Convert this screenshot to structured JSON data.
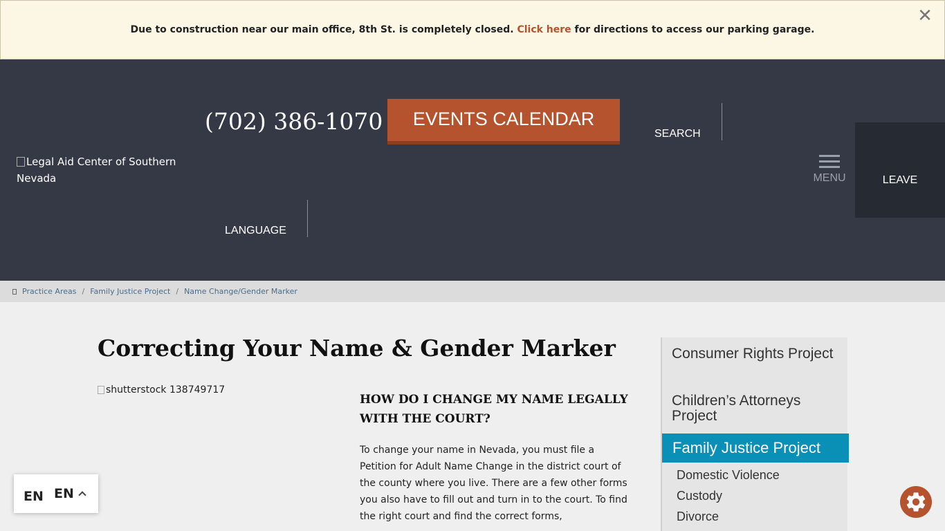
{
  "alert": {
    "text_before": "Due to construction near our main office, 8th St. is completely closed.",
    "link_text": "Click here",
    "text_after": "for directions to access our parking garage.",
    "close_glyph": "✕"
  },
  "header": {
    "logo_alt": "Legal Aid Center of Southern Nevada",
    "phone": "(702) 386-1070",
    "events_button": "EVENTS CALENDAR",
    "search_label": "SEARCH",
    "menu_label": "MENU",
    "leave_label": "LEAVE",
    "language_label": "LANGUAGE"
  },
  "breadcrumb": {
    "items": [
      "Practice Areas",
      "Family Justice Project",
      "Name Change/Gender Marker"
    ],
    "separator": "/"
  },
  "main": {
    "title": "Correcting Your Name & Gender Marker",
    "image_alt": "shutterstock 138749717",
    "heading": "HOW DO I CHANGE MY NAME LEGALLY WITH THE COURT?",
    "body": "To change your name in Nevada, you must file a Petition for Adult Name Change in the district court of the county where you live. There are a few other forms you also have to fill out and turn in to the court. To find the right court and find the correct forms,"
  },
  "sidebar": {
    "items": [
      "Consumer Rights Project",
      "Children’s Attorneys Project"
    ],
    "active": "Family Justice Project",
    "sub_items": [
      "Domestic Violence",
      "Custody",
      "Divorce"
    ]
  },
  "language_widget": {
    "flag_alt": "EN",
    "code": "EN"
  },
  "colors": {
    "accent": "#b5532e",
    "header_bg": "#353945",
    "sidebar_active": "#0a8fb6"
  }
}
